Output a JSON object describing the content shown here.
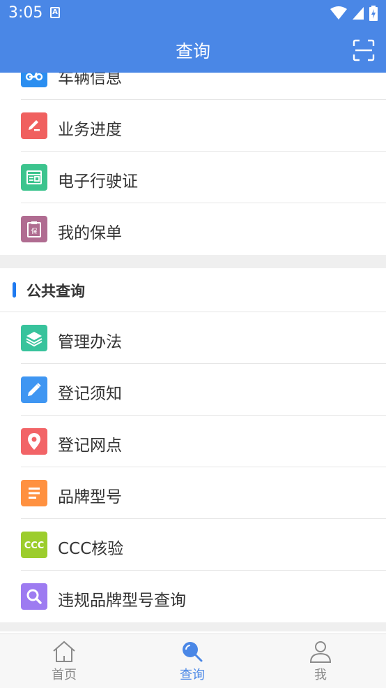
{
  "status_bar": {
    "time": "3:05",
    "notification_glyph": "A"
  },
  "app_bar": {
    "title": "查询"
  },
  "personal_items": [
    {
      "label": "车辆信息",
      "icon": "scooter-icon",
      "color": "#2b8ef0"
    },
    {
      "label": "业务进度",
      "icon": "edit-progress-icon",
      "color": "#f0605f"
    },
    {
      "label": "电子行驶证",
      "icon": "license-card-icon",
      "color": "#3cc48e"
    },
    {
      "label": "我的保单",
      "icon": "insurance-clipboard-icon",
      "color": "#b06c91"
    }
  ],
  "insurance_glyph": "保",
  "public_section": {
    "title": "公共查询"
  },
  "public_items": [
    {
      "label": "管理办法",
      "icon": "layers-icon",
      "color": "#38c39c"
    },
    {
      "label": "登记须知",
      "icon": "pencil-icon",
      "color": "#3f96f2"
    },
    {
      "label": "登记网点",
      "icon": "location-pin-icon",
      "color": "#f26467"
    },
    {
      "label": "品牌型号",
      "icon": "list-lines-icon",
      "color": "#ff9140"
    },
    {
      "label": "CCC核验",
      "icon": "ccc-icon",
      "color": "#9ccd2c"
    },
    {
      "label": "违规品牌型号查询",
      "icon": "magnifier-icon",
      "color": "#9d7bf1"
    }
  ],
  "ccc_glyph": "CCC",
  "tab_bar": {
    "tabs": [
      {
        "label": "首页",
        "icon": "home-icon"
      },
      {
        "label": "查询",
        "icon": "search-icon",
        "active": true
      },
      {
        "label": "我",
        "icon": "person-icon"
      }
    ]
  }
}
